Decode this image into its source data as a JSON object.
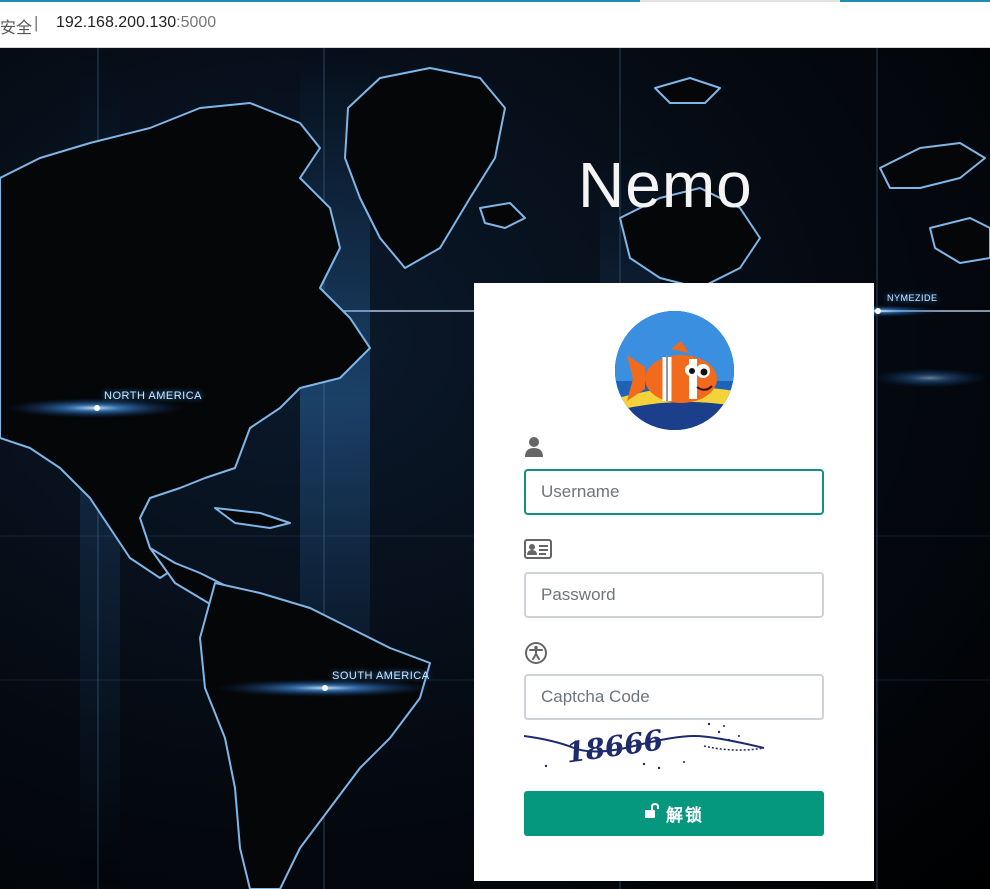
{
  "browser": {
    "security_label": "安全",
    "separator": "|",
    "url_host": "192.168.200.130",
    "url_port": ":5000"
  },
  "background": {
    "labels": {
      "north_america": "NORTH AMERICA",
      "south_america": "SOUTH AMERICA",
      "europe": "NYMEZIDE"
    }
  },
  "app": {
    "title": "Nemo"
  },
  "login": {
    "username": {
      "icon": "user-icon",
      "placeholder": "Username",
      "value": ""
    },
    "password": {
      "icon": "id-card-icon",
      "placeholder": "Password",
      "value": ""
    },
    "captcha": {
      "icon": "accessibility-icon",
      "placeholder": "Captcha Code",
      "value": "",
      "image_text": "18666"
    },
    "submit": {
      "icon": "unlock-icon",
      "label": "解锁"
    }
  },
  "colors": {
    "accent": "#06977f",
    "focus_border": "#13907f",
    "panel_bg": "#ffffff"
  }
}
